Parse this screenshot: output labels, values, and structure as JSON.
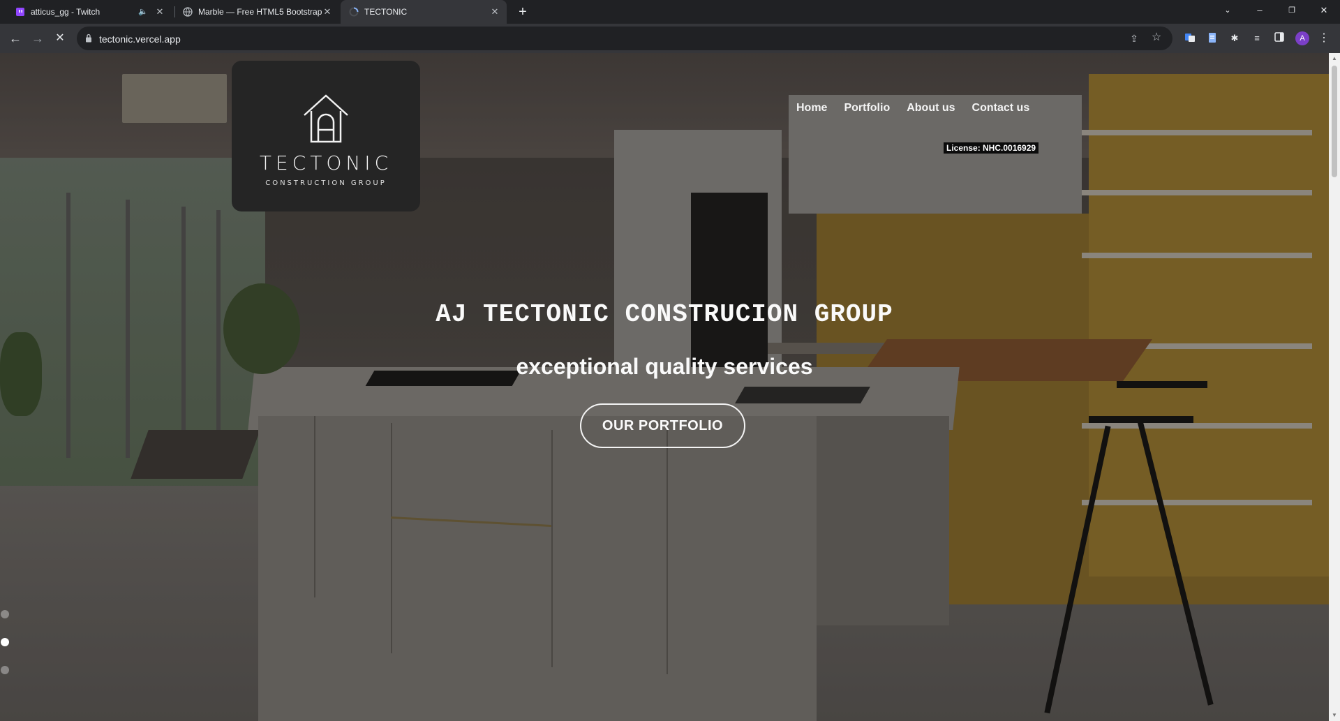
{
  "browser": {
    "tabs": [
      {
        "title": "atticus_gg - Twitch",
        "icon": "twitch-icon",
        "audio": true,
        "active": false
      },
      {
        "title": "Marble — Free HTML5 Bootstrap",
        "icon": "globe-icon",
        "audio": false,
        "active": false
      },
      {
        "title": "TECTONIC",
        "icon": "loading-spinner-icon",
        "audio": false,
        "active": true
      }
    ],
    "url": "tectonic.vercel.app",
    "profile_initial": "A"
  },
  "site": {
    "logo_word": "TECTONIC",
    "logo_sub": "CONSTRUCTION GROUP",
    "nav": [
      "Home",
      "Portfolio",
      "About us",
      "Contact us"
    ],
    "license": "License: NHC.0016929",
    "hero_title": "AJ TECTONIC CONSTRUCION GROUP",
    "hero_subtitle": "exceptional quality services",
    "hero_button": "OUR PORTFOLIO",
    "slider_active_index": 1,
    "slider_count": 3
  },
  "colors": {
    "chrome_dark": "#202124",
    "chrome_toolbar": "#35363a",
    "logo_card": "#252525",
    "accent_yellow": "#d9a53a"
  }
}
